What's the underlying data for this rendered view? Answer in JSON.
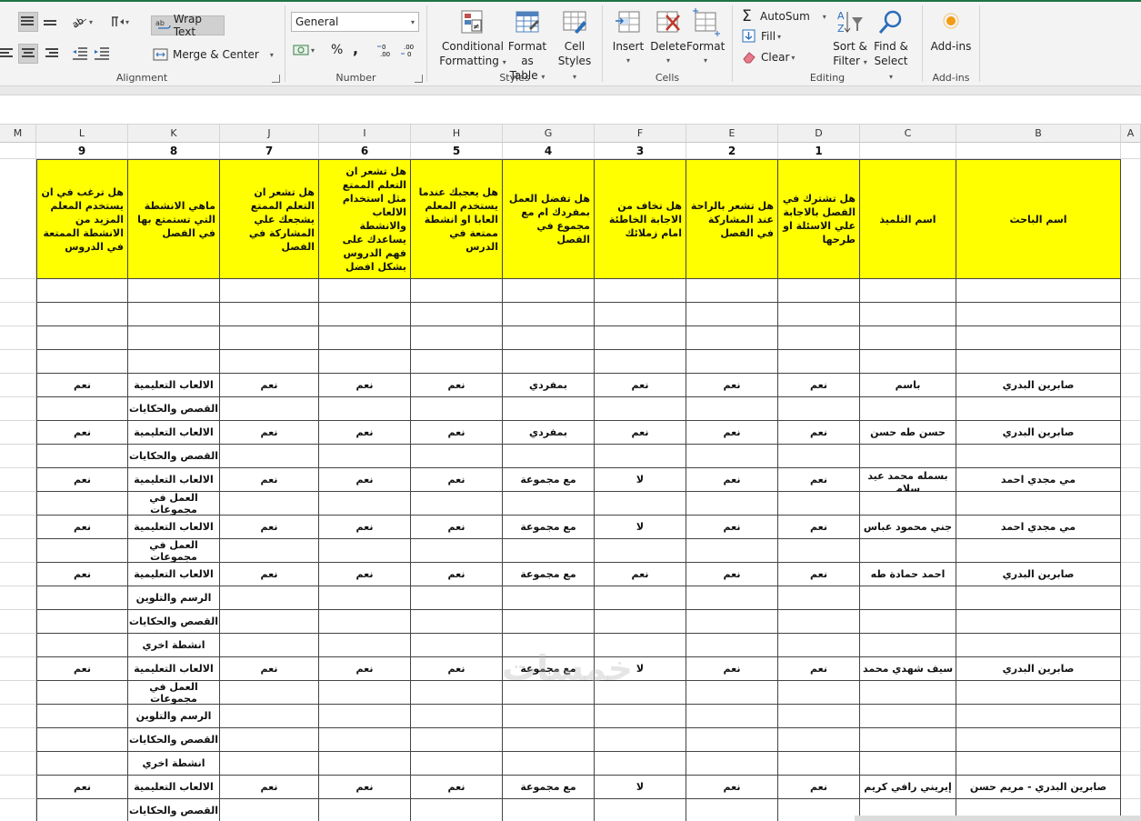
{
  "ribbon": {
    "alignment": {
      "wrap_text": "Wrap Text",
      "merge_center": "Merge & Center",
      "label": "Alignment"
    },
    "number": {
      "format": "General",
      "label": "Number",
      "percent": "%",
      "comma": ","
    },
    "styles": {
      "conditional": [
        "Conditional",
        "Formatting"
      ],
      "format_table": [
        "Format as",
        "Table"
      ],
      "cell_styles": [
        "Cell",
        "Styles"
      ],
      "label": "Styles"
    },
    "cells": {
      "insert": "Insert",
      "delete": "Delete",
      "format": "Format",
      "label": "Cells"
    },
    "editing": {
      "autosum": "AutoSum",
      "fill": "Fill",
      "clear": "Clear",
      "sort_filter": [
        "Sort &",
        "Filter"
      ],
      "find_select": [
        "Find &",
        "Select"
      ],
      "label": "Editing"
    },
    "addins": {
      "button": "Add-ins",
      "label": "Add-ins"
    }
  },
  "sheet": {
    "column_letters": [
      "M",
      "L",
      "K",
      "J",
      "I",
      "H",
      "G",
      "F",
      "E",
      "D",
      "C",
      "B",
      "A"
    ],
    "question_numbers": [
      "9",
      "8",
      "7",
      "6",
      "5",
      "4",
      "3",
      "2",
      "1"
    ],
    "headers": [
      "هل ترغب في ان يستخدم المعلم المزيد من الانشطة الممتعة في الدروس",
      "ماهي الانشطة التي تستمتع بها في الفصل",
      "هل تشعر ان التعلم الممتع يشجعك علي المشاركة في الفصل",
      "هل تشعر ان التعلم الممتع مثل استخدام الالعاب والانشطة يساعدك على فهم الدروس بشكل افضل",
      "هل يعجبك عندما يستخدم المعلم العابا او انشطة ممتعة في الدرس",
      "هل تفضل العمل بمفردك ام مع مجموع في الفصل",
      "هل تخاف من الاجابة الخاطئة امام زملائك",
      "هل تشعر بالراحة عند المشاركة في الفصل",
      "هل تشترك في الفصل بالاجابة علي الاسئلة او طرحها",
      "اسم التلميذ",
      "اسم الباحث"
    ],
    "rows": [
      [
        "",
        "",
        "",
        "",
        "",
        "",
        "",
        "",
        "",
        "",
        ""
      ],
      [
        "",
        "",
        "",
        "",
        "",
        "",
        "",
        "",
        "",
        "",
        ""
      ],
      [
        "",
        "",
        "",
        "",
        "",
        "",
        "",
        "",
        "",
        "",
        ""
      ],
      [
        "",
        "",
        "",
        "",
        "",
        "",
        "",
        "",
        "",
        "",
        ""
      ],
      [
        "نعم",
        "الالعاب التعليمية",
        "نعم",
        "نعم",
        "نعم",
        "بمفردي",
        "نعم",
        "نعم",
        "نعم",
        "باسم",
        "صابرين البدري"
      ],
      [
        "",
        "القصص والحكايات",
        "",
        "",
        "",
        "",
        "",
        "",
        "",
        "",
        ""
      ],
      [
        "نعم",
        "الالعاب التعليمية",
        "نعم",
        "نعم",
        "نعم",
        "بمفردي",
        "نعم",
        "نعم",
        "نعم",
        "حسن طه حسن",
        "صابرين البدري"
      ],
      [
        "",
        "القصص والحكايات",
        "",
        "",
        "",
        "",
        "",
        "",
        "",
        "",
        ""
      ],
      [
        "نعم",
        "الالعاب التعليمية",
        "نعم",
        "نعم",
        "نعم",
        "مع مجموعة",
        "لا",
        "نعم",
        "نعم",
        "بسمله محمد عيد سلام",
        "مي مجدي احمد"
      ],
      [
        "",
        "العمل في مجموعات",
        "",
        "",
        "",
        "",
        "",
        "",
        "",
        "",
        ""
      ],
      [
        "نعم",
        "الالعاب التعليمية",
        "نعم",
        "نعم",
        "نعم",
        "مع مجموعة",
        "لا",
        "نعم",
        "نعم",
        "جني محمود عباس",
        "مي مجدي احمد"
      ],
      [
        "",
        "العمل في مجموعات",
        "",
        "",
        "",
        "",
        "",
        "",
        "",
        "",
        ""
      ],
      [
        "نعم",
        "الالعاب التعليمية",
        "نعم",
        "نعم",
        "نعم",
        "مع مجموعة",
        "نعم",
        "نعم",
        "نعم",
        "احمد حمادة طه",
        "صابرين البدري"
      ],
      [
        "",
        "الرسم والتلوين",
        "",
        "",
        "",
        "",
        "",
        "",
        "",
        "",
        ""
      ],
      [
        "",
        "القصص والحكايات",
        "",
        "",
        "",
        "",
        "",
        "",
        "",
        "",
        ""
      ],
      [
        "",
        "انشطة اخري",
        "",
        "",
        "",
        "",
        "",
        "",
        "",
        "",
        ""
      ],
      [
        "نعم",
        "الالعاب التعليمية",
        "نعم",
        "نعم",
        "نعم",
        "مع مجموعة",
        "لا",
        "نعم",
        "نعم",
        "سيف شهدي محمد",
        "صابرين البدري"
      ],
      [
        "",
        "العمل في مجموعات",
        "",
        "",
        "",
        "",
        "",
        "",
        "",
        "",
        ""
      ],
      [
        "",
        "الرسم والتلوين",
        "",
        "",
        "",
        "",
        "",
        "",
        "",
        "",
        ""
      ],
      [
        "",
        "القصص والحكايات",
        "",
        "",
        "",
        "",
        "",
        "",
        "",
        "",
        ""
      ],
      [
        "",
        "انشطة اخري",
        "",
        "",
        "",
        "",
        "",
        "",
        "",
        "",
        ""
      ],
      [
        "نعم",
        "الالعاب التعليمية",
        "نعم",
        "نعم",
        "نعم",
        "مع مجموعة",
        "لا",
        "نعم",
        "نعم",
        "إيريني رافي كريم",
        "صابرين البدري - مريم حسن"
      ],
      [
        "",
        "القصص والحكايات",
        "",
        "",
        "",
        "",
        "",
        "",
        "",
        "",
        ""
      ]
    ],
    "watermark": "خمسات"
  },
  "colors": {
    "header_fill": "#ffff00",
    "excel_green": "#217346"
  }
}
